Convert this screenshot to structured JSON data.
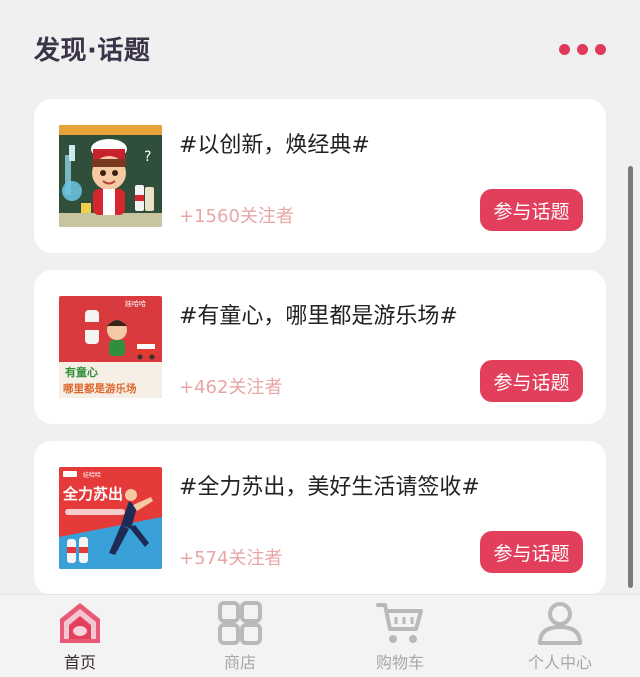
{
  "header": {
    "title": "发现·话题"
  },
  "topics": [
    {
      "title": "#以创新，焕经典#",
      "followers": "+1560关注者",
      "join_label": "参与话题",
      "thumb_icon": "cartoon-chef-chemistry"
    },
    {
      "title": "#有童心，哪里都是游乐场#",
      "followers": "+462关注者",
      "join_label": "参与话题",
      "thumb_icon": "cartoon-playground-poster"
    },
    {
      "title": "#全力苏出，美好生活请签收#",
      "followers": "+574关注者",
      "join_label": "参与话题",
      "thumb_icon": "running-athlete-poster"
    }
  ],
  "thumbs": {
    "t2_brand": "娃哈哈",
    "t2_line1": "有童心",
    "t2_line2": "哪里都是游乐场",
    "t3_brand": "娃哈哈",
    "t3_headline": "全力苏出"
  },
  "tabs": [
    {
      "label": "首页",
      "icon": "home-icon",
      "active": true
    },
    {
      "label": "商店",
      "icon": "grid-icon",
      "active": false
    },
    {
      "label": "购物车",
      "icon": "cart-icon",
      "active": false
    },
    {
      "label": "个人中心",
      "icon": "user-icon",
      "active": false
    }
  ],
  "colors": {
    "accent": "#e23f5d",
    "title": "#3b3448",
    "followers": "#e8a6a6",
    "background": "#f1f0f0",
    "tab_inactive": "#a7a7a7"
  }
}
